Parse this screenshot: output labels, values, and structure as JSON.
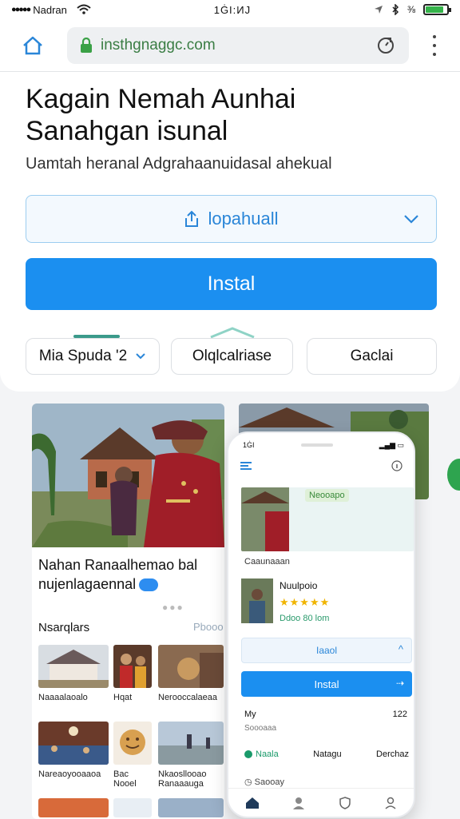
{
  "status_bar": {
    "carrier": "Nadran",
    "time": "1ĠI:ИJ",
    "signal_dots": "●●●●●"
  },
  "browser": {
    "url": "insthgnaggc.com"
  },
  "hero": {
    "title_line1": "Kagain Nemah Aunhai",
    "title_line2": "Sanahgan isunal",
    "subtitle": "Uamtah heranal Adgrahaanuidasal ahekual",
    "dropdown_label": "lopahuall",
    "install_label": "Instal"
  },
  "chips": [
    "Mia Spuda '2",
    "Olqlcalriase",
    "Gaclai"
  ],
  "card": {
    "caption_line1": "Nahan Ranaalhemao bal",
    "caption_line2": "nujenlagaennal",
    "related_title": "Nsarqlars",
    "related_alt": "Pbooo",
    "grid_items": [
      "Naaaalaoalo",
      "Hqat",
      "Nerooccalaeaa",
      "Nareaoyooaaoa",
      "Bac Nooel",
      "Nkaosllooao Ranaaauga"
    ]
  },
  "phone": {
    "time": "1ĠI",
    "hero_label": "Neooapo",
    "section": "Caaunaaan",
    "app_name": "Nuulpoio",
    "app_stars": "★★★★★",
    "app_size": "Ddoo 80 lom",
    "dropdown_label": "Iaaol",
    "install_label": "Instal",
    "row_left": "My",
    "row_right": "122",
    "row_sub": "Soooaaa",
    "tabs": [
      "Naala",
      "Natagu",
      "Derchaz"
    ],
    "footer": "Saooay"
  },
  "colors": {
    "accent": "#1b8ff0",
    "secure_green": "#3a7d44",
    "tab_green": "#1a9a6a"
  }
}
